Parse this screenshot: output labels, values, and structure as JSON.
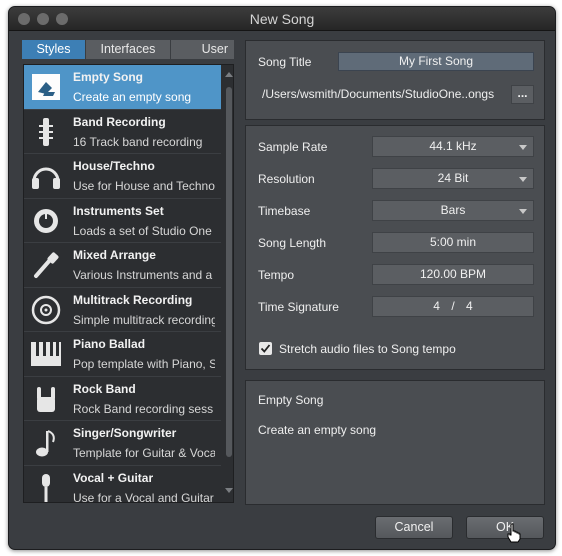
{
  "window": {
    "title": "New Song"
  },
  "tabs": [
    {
      "label": "Styles",
      "active": true
    },
    {
      "label": "Interfaces",
      "active": false
    },
    {
      "label": "User",
      "active": false
    }
  ],
  "templates": [
    {
      "name": "Empty Song",
      "desc": "Create an empty song",
      "icon": "empty-song-icon",
      "selected": true
    },
    {
      "name": "Band Recording",
      "desc": "16 Track band recording",
      "icon": "drumstick-icon"
    },
    {
      "name": "House/Techno",
      "desc": "Use for House and Techno",
      "icon": "headphones-icon"
    },
    {
      "name": "Instruments Set",
      "desc": "Loads a set of  Studio One",
      "icon": "knob-icon"
    },
    {
      "name": "Mixed Arrange",
      "desc": "Various Instruments and a",
      "icon": "guitar-cable-icon"
    },
    {
      "name": "Multitrack Recording",
      "desc": "Simple multitrack recording",
      "icon": "disc-icon"
    },
    {
      "name": "Piano Ballad",
      "desc": "Pop template with Piano, S",
      "icon": "piano-keys-icon"
    },
    {
      "name": "Rock Band",
      "desc": "Rock Band recording sess",
      "icon": "rock-hand-icon"
    },
    {
      "name": "Singer/Songwriter",
      "desc": "Template for Guitar & Voca",
      "icon": "music-note-icon"
    },
    {
      "name": "Vocal + Guitar",
      "desc": "Use for a Vocal and Guitar",
      "icon": "microphone-icon"
    }
  ],
  "song": {
    "title_label": "Song Title",
    "title_value": "My First Song",
    "path": "/Users/wsmith/Documents/StudioOne..ongs",
    "browse_label": "..."
  },
  "settings": {
    "sample_rate_label": "Sample Rate",
    "sample_rate": "44.1 kHz",
    "resolution_label": "Resolution",
    "resolution": "24 Bit",
    "timebase_label": "Timebase",
    "timebase": "Bars",
    "song_length_label": "Song Length",
    "song_length": "5:00 min",
    "tempo_label": "Tempo",
    "tempo": "120.00 BPM",
    "time_sig_label": "Time Signature",
    "time_sig_num": "4",
    "time_sig_sep": "/",
    "time_sig_den": "4",
    "stretch_label": "Stretch audio files to Song tempo",
    "stretch_checked": true
  },
  "description": {
    "title": "Empty Song",
    "text": "Create an empty song"
  },
  "buttons": {
    "cancel": "Cancel",
    "ok": "OK"
  },
  "colors": {
    "accent": "#4f95c8",
    "window_bg": "#3a3d41",
    "panel_bg": "#4a4d51"
  }
}
